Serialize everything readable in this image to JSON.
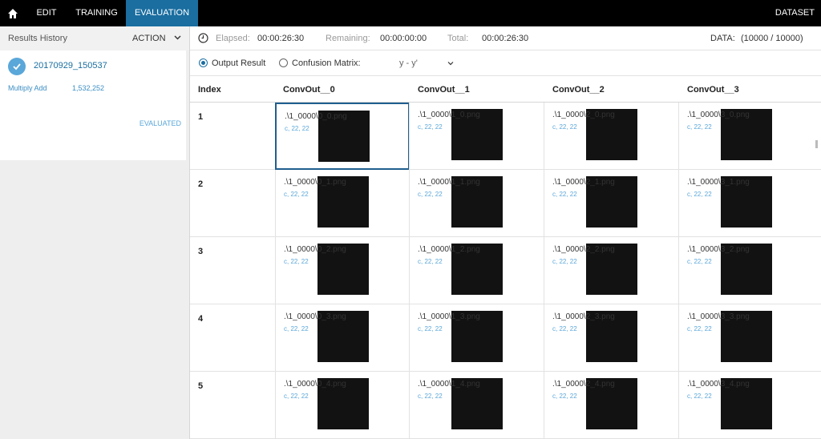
{
  "topbar": {
    "tabs": [
      "EDIT",
      "TRAINING",
      "EVALUATION"
    ],
    "active_tab": "EVALUATION",
    "dataset_label": "DATASET"
  },
  "sidebar": {
    "title": "Results History",
    "action_label": "ACTION",
    "result": {
      "name": "20170929_150537",
      "metric_label": "Multiply Add",
      "metric_value": "1,532,252",
      "status": "EVALUATED"
    }
  },
  "stats": {
    "elapsed_label": "Elapsed:",
    "elapsed_value": "00:00:26:30",
    "remaining_label": "Remaining:",
    "remaining_value": "00:00:00:00",
    "total_label": "Total:",
    "total_value": "00:00:26:30",
    "data_label": "DATA:",
    "data_value": "(10000 / 10000)"
  },
  "options": {
    "output_result": "Output Result",
    "confusion_matrix": "Confusion Matrix:",
    "selector_value": "y - y'"
  },
  "table": {
    "headers": [
      "Index",
      "ConvOut__0",
      "ConvOut__1",
      "ConvOut__2",
      "ConvOut__3"
    ],
    "rows": [
      {
        "index": "1",
        "cells": [
          ".\\1_0000\\0_0.png",
          ".\\1_0000\\1_0.png",
          ".\\1_0000\\2_0.png",
          ".\\1_0000\\3_0.png"
        ]
      },
      {
        "index": "2",
        "cells": [
          ".\\1_0000\\0_1.png",
          ".\\1_0000\\1_1.png",
          ".\\1_0000\\2_1.png",
          ".\\1_0000\\3_1.png"
        ]
      },
      {
        "index": "3",
        "cells": [
          ".\\1_0000\\0_2.png",
          ".\\1_0000\\1_2.png",
          ".\\1_0000\\2_2.png",
          ".\\1_0000\\3_2.png"
        ]
      },
      {
        "index": "4",
        "cells": [
          ".\\1_0000\\0_3.png",
          ".\\1_0000\\1_3.png",
          ".\\1_0000\\2_3.png",
          ".\\1_0000\\3_3.png"
        ]
      },
      {
        "index": "5",
        "cells": [
          ".\\1_0000\\0_4.png",
          ".\\1_0000\\1_4.png",
          ".\\1_0000\\2_4.png",
          ".\\1_0000\\3_4.png"
        ]
      }
    ],
    "cell_dims": "c, 22, 22"
  },
  "colors": {
    "accent": "#1a6ea0",
    "link": "#5aa7d9",
    "topbar": "#000000"
  }
}
